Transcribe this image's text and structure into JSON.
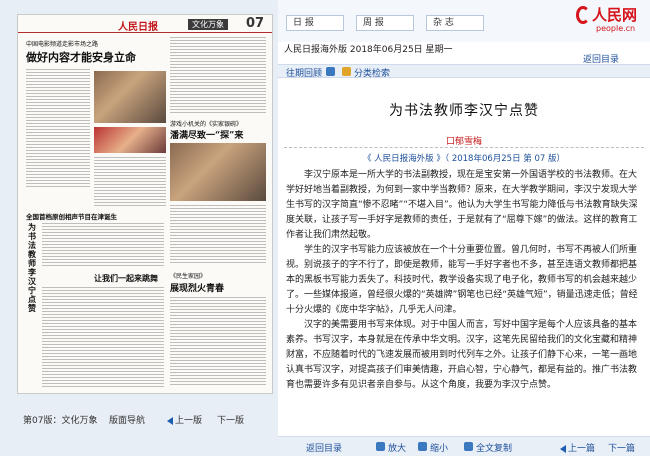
{
  "paper": {
    "logo": "人民日报",
    "section": "文化万象",
    "page_no": "07",
    "small_head": "中国电影频道走影市场之路",
    "headline_main": "做好内容才能安身立命",
    "headline_mid": "游戏小机关的《实家银碗》",
    "headline_mid2": "潘满尽致一“探”来",
    "headline_left1": "全国首档原创相声节目在津诞生",
    "headline_left2": "让我们一起来跳舞",
    "headline_small": "《民生家园》",
    "headline_right": "展现烈火青春",
    "vertical_title": "为书法教师李汉宁点赞"
  },
  "pagebar": {
    "page_label": "第07版：文化万象",
    "nav_label": "版面导航",
    "prev_label": "上一版",
    "next_label": "下一版"
  },
  "topnav": {
    "tab_daily": "日 报",
    "tab_weekly": "周 报",
    "tab_magazine": "杂 志",
    "logo_cn": "人民网",
    "logo_en": "people.cn"
  },
  "dateline": "人民日报海外版  2018年06月25日  星期一",
  "back_label": "返回目录",
  "tools": {
    "archive_label": "往期回顾",
    "category_label": "分类检索"
  },
  "article": {
    "title": "为书法教师李汉宁点赞",
    "author": "口郁雪梅",
    "source": "《 人民日报海外版 》（ 2018年06月25日    第  07 版）",
    "paragraphs": [
      "李汉宁原本是一所大学的书法副教授，现在是宝安第一外国语学校的书法教师。在大学好好地当着副教授，为何到一家中学当教师？原来，在大学教学期间，李汉宁发现大学生书写的汉字简直“惨不忍睹”“不堪入目”。他认为大学生书写能力降低与书法教育缺失深度关联，让孩子写一手好字是教师的责任，于是就有了“屈尊下嫁”的做法。这样的教育工作者让我们肃然起敬。",
      "学生的汉字书写能力应该被放在一个十分重要位置。曾几何时，书写不再被人们所重视。别说孩子的字不行了，即使是教师，能写一手好字者也不多，甚至连语文教师都把基本的黑板书写能力丢失了。科技时代，教学设备实现了电子化，教师书写的机会越来越少了。一些媒体报道，曾经很火爆的“英雄牌”钢笔也已经“英雄气短”，销量迅速走低；曾经十分火爆的《庞中华字帖》，几乎无人问津。",
      "汉字的美需要用书写来体现。对于中国人而言，写好中国字是每个人应该具备的基本素养。书写汉字，本身就是在传承中华文明。汉字，这笔先民留给我们的文化宝藏和精神财富，不应随着时代的飞速发展而被用到时代列车之外。让孩子们静下心来，一笔一画地认真书写汉字，对提高孩子们审美情趣，开启心智，宁心静气，都是有益的。推广书法教育也需要许多有见识者亲自参与。从这个角度，我要为李汉宁点赞。"
    ]
  },
  "bottombar": {
    "back_label": "返回目录",
    "zoom_in": "放大",
    "zoom_out": "缩小",
    "fulltext": "全文复制",
    "prev": "上一篇",
    "next": "下一篇"
  },
  "colors": {
    "brand_red": "#d6141b",
    "link_blue": "#1d4f9b",
    "bar_bg": "#e9eff7"
  }
}
